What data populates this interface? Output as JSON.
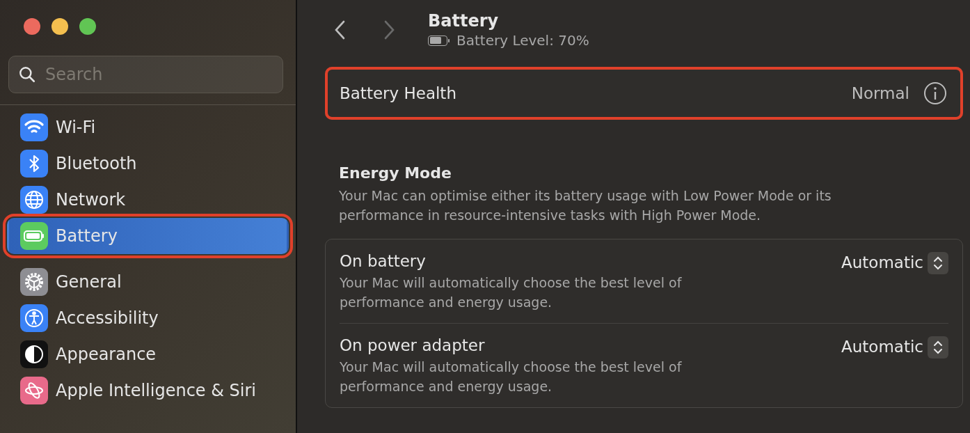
{
  "window": {
    "controls": [
      {
        "color": "#ec6a5e"
      },
      {
        "color": "#f4bf4f"
      },
      {
        "color": "#61c554"
      }
    ]
  },
  "sidebar": {
    "search": {
      "placeholder": "Search"
    },
    "groups": [
      [
        {
          "label": "Wi-Fi",
          "selected": false,
          "highlighted": false
        },
        {
          "label": "Bluetooth",
          "selected": false,
          "highlighted": false
        },
        {
          "label": "Network",
          "selected": false,
          "highlighted": false
        },
        {
          "label": "Battery",
          "selected": true,
          "highlighted": true
        }
      ],
      [
        {
          "label": "General",
          "selected": false,
          "highlighted": false
        },
        {
          "label": "Accessibility",
          "selected": false,
          "highlighted": false
        },
        {
          "label": "Appearance",
          "selected": false,
          "highlighted": false
        },
        {
          "label": "Apple Intelligence & Siri",
          "selected": false,
          "highlighted": false
        }
      ]
    ]
  },
  "header": {
    "title": "Battery",
    "subtitle": "Battery Level: 70%",
    "level": 0.7
  },
  "battery_health": {
    "label": "Battery Health",
    "value": "Normal",
    "highlighted": true
  },
  "energy_mode": {
    "title": "Energy Mode",
    "description": "Your Mac can optimise either its battery usage with Low Power Mode or its performance in resource-intensive tasks with High Power Mode.",
    "rows": [
      {
        "label": "On battery",
        "description": "Your Mac will automatically choose the best level of performance and energy usage.",
        "value": "Automatic"
      },
      {
        "label": "On power adapter",
        "description": "Your Mac will automatically choose the best level of performance and energy usage.",
        "value": "Automatic"
      }
    ]
  }
}
